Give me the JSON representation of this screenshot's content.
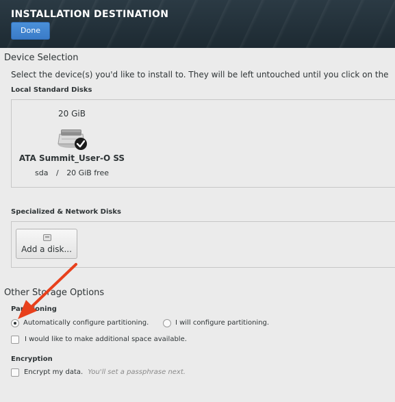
{
  "header": {
    "title": "INSTALLATION DESTINATION",
    "done_label": "Done"
  },
  "device_selection": {
    "title": "Device Selection",
    "description": "Select the device(s) you'd like to install to.  They will be left untouched until you click on the"
  },
  "local_disks": {
    "title": "Local Standard Disks",
    "disks": [
      {
        "size": "20 GiB",
        "name": "ATA Summit_User-O SS",
        "device": "sda",
        "separator": "/",
        "free": "20 GiB free",
        "selected": true
      }
    ]
  },
  "network_disks": {
    "title": "Specialized & Network Disks",
    "add_label": "Add a disk..."
  },
  "other_options": {
    "title": "Other Storage Options",
    "partitioning": {
      "title": "Partitioning",
      "auto_label": "Automatically configure partitioning.",
      "manual_label": "I will configure partitioning.",
      "selected": "auto",
      "extra_space_label": "I would like to make additional space available."
    },
    "encryption": {
      "title": "Encryption",
      "encrypt_label": "Encrypt my data.",
      "encrypt_hint": "You'll set a passphrase next."
    }
  },
  "colors": {
    "header_bg": "#1d2a32",
    "accent": "#3a7bc8",
    "annotation_arrow": "#e8401c"
  }
}
